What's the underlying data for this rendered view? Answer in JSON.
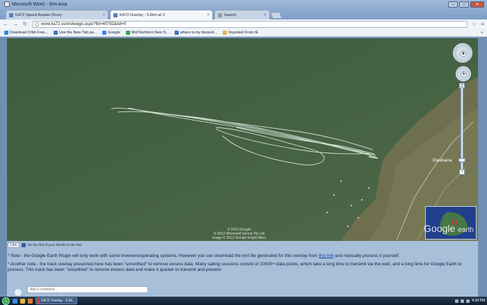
{
  "os": {
    "title": "Microsoft Word - Sim Ana"
  },
  "window_controls": {
    "minimize": "–",
    "maximize": "□",
    "close": "✕"
  },
  "tabs": [
    {
      "label": "KA72 Speed Reader (Free)",
      "close": "×"
    },
    {
      "label": "KA72 Overlay - 5.6km at V",
      "close": "×"
    },
    {
      "label": "Search",
      "close": "×"
    }
  ],
  "toolbar": {
    "url": "www.ka72.com/viewge.aspx?fid=45792&tid=0"
  },
  "bookmarks": [
    {
      "label": "Download IObit Free...",
      "color": "#2f8fd8"
    },
    {
      "label": "Use the New Tab pa...",
      "color": "#4a73c0"
    },
    {
      "label": "Google",
      "color": "#4285f4"
    },
    {
      "label": "Mid Northern New S...",
      "color": "#3aa14c"
    },
    {
      "label": "where is my favourit...",
      "color": "#4a73c0"
    },
    {
      "label": "Imported From IE",
      "color": "#e6b84a"
    }
  ],
  "bookmarks_other": "»",
  "map": {
    "place_name": "Eleebana",
    "copyright": [
      "© 2013 Google",
      "© 2013 Whereis® Sensis Pty Ltd",
      "Image © 2013 Sinclair Knight Merz"
    ],
    "logo_google": "Google",
    "logo_earth": "earth",
    "colors": {
      "water": "#3e5a3e",
      "track": "#dfeee4",
      "land": "#6b6e4e"
    }
  },
  "facebook": {
    "like": "Like",
    "text": "Be the first of your friends to like this."
  },
  "notes": {
    "note1_pre": "* Note - the Google Earth Plugin will only work with some browsers/operating systems. However you can download the kml file generated for this overlay from ",
    "note1_link": "this link",
    "note1_post": " and manually process it yourself.",
    "note2": "* Another note - the track overlay presented here has been \"smoothed\" to remove excess data. Many sailing sessions consist of 10000+ data points, which take a long time to transmit via the web, and a long time for Google Earth to process. This track has been \"smoothed\" to remove excess data and make it quicker to transmit and present."
  },
  "comment": {
    "placeholder": "Add a comment..."
  },
  "taskbar": {
    "task_label": "KA72 Overlay - 5.6k...",
    "clock": "8:38 PM"
  }
}
